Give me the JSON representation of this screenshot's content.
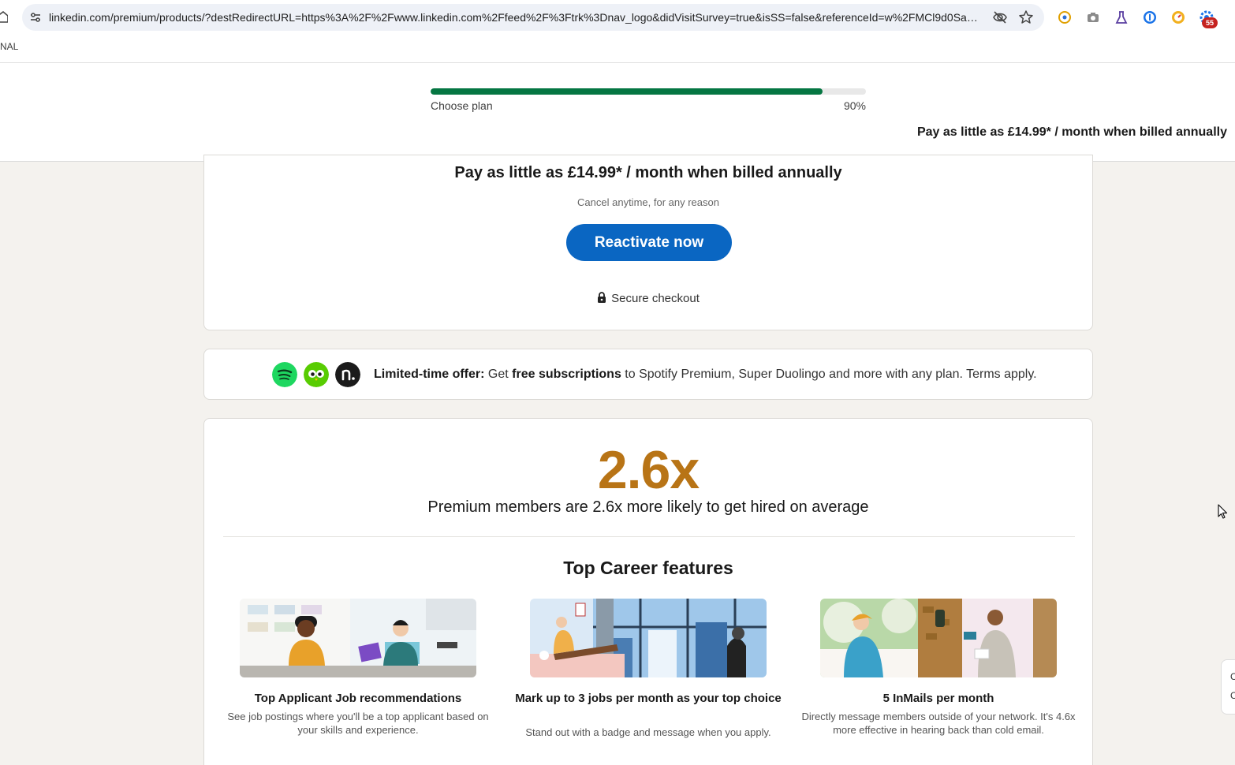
{
  "browser": {
    "url": "linkedin.com/premium/products/?destRedirectURL=https%3A%2F%2Fwww.linkedin.com%2Ffeed%2F%3Ftrk%3Dnav_logo&didVisitSurvey=true&isSS=false&referenceId=w%2FMCl9d0SaSIA...",
    "bookmark_label": "NAL",
    "extension_badge": "55"
  },
  "progress": {
    "label": "Choose plan",
    "percent_text": "90%",
    "percent": 90
  },
  "header": {
    "price_text": "Pay as little as £14.99* / month when billed annually"
  },
  "pricing": {
    "price_text": "Pay as little as £14.99* / month when billed annually",
    "cancel_text": "Cancel anytime, for any reason",
    "cta_label": "Reactivate now",
    "secure_label": "Secure checkout"
  },
  "offer": {
    "logos": [
      "spotify-logo",
      "duolingo-logo",
      "noom-logo"
    ],
    "lead": "Limited-time offer:",
    "text_1": " Get ",
    "highlight": "free subscriptions",
    "text_2": " to Spotify Premium, Super Duolingo and more with any plan. Terms apply."
  },
  "stats": {
    "number": "2.6x",
    "caption": "Premium members are 2.6x more likely to get hired on average"
  },
  "features": {
    "title": "Top Career features",
    "items": [
      {
        "title": "Top Applicant Job recommendations",
        "desc": "See job postings where you'll be a top applicant based on your skills and experience."
      },
      {
        "title": "Mark up to 3 jobs per month as your top choice",
        "desc": "Stand out with a badge and message when you apply."
      },
      {
        "title": "5 InMails per month",
        "desc": "Directly message members outside of your network. It's 4.6x more effective in hearing back than cold email."
      }
    ]
  },
  "side_tab": {
    "line_1": "C",
    "line_2": "C"
  },
  "colors": {
    "primary_button": "#0a66c2",
    "progress": "#057642",
    "stat": "#b87416",
    "page_bg": "#f4f2ee"
  }
}
